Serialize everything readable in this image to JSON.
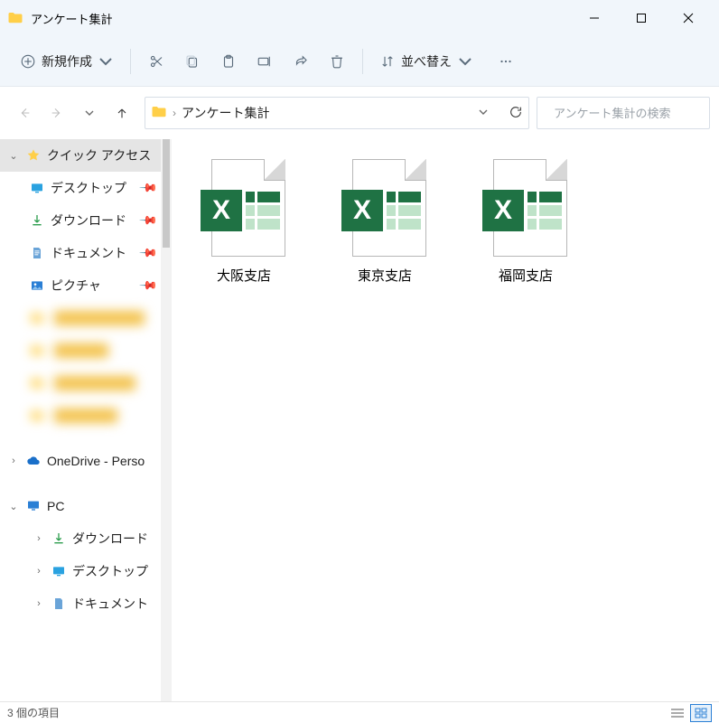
{
  "window": {
    "title": "アンケート集計"
  },
  "toolbar": {
    "new_label": "新規作成",
    "sort_label": "並べ替え"
  },
  "address": {
    "crumb": "アンケート集計"
  },
  "search": {
    "placeholder": "アンケート集計の検索"
  },
  "sidebar": {
    "quick_access": "クイック アクセス",
    "desktop": "デスクトップ",
    "downloads": "ダウンロード",
    "documents": "ドキュメント",
    "pictures": "ピクチャ",
    "onedrive": "OneDrive - Perso",
    "pc": "PC",
    "pc_downloads": "ダウンロード",
    "pc_desktop": "デスクトップ",
    "pc_documents": "ドキュメント"
  },
  "files": [
    {
      "name": "大阪支店"
    },
    {
      "name": "東京支店"
    },
    {
      "name": "福岡支店"
    }
  ],
  "status": {
    "count_text": "3 個の項目"
  }
}
